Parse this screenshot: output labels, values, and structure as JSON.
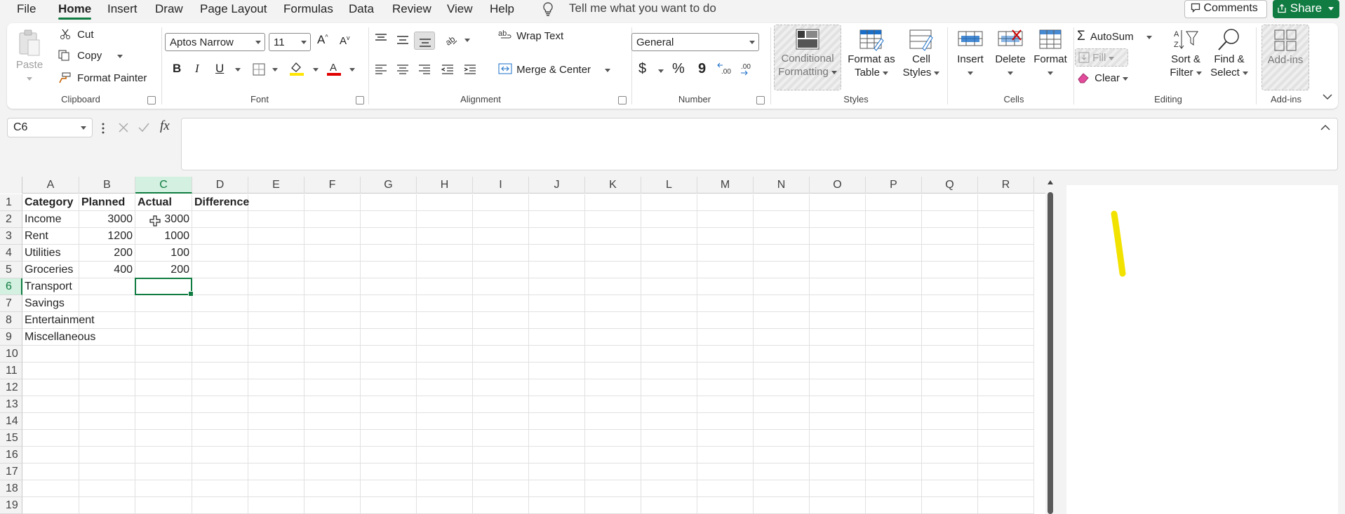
{
  "menubar": {
    "items": [
      "File",
      "Home",
      "Insert",
      "Draw",
      "Page Layout",
      "Formulas",
      "Data",
      "Review",
      "View",
      "Help"
    ],
    "active": "Home",
    "tell_me": "Tell me what you want to do",
    "comments_label": "Comments",
    "share_label": "Share"
  },
  "ribbon": {
    "clipboard": {
      "paste": "Paste",
      "cut": "Cut",
      "copy": "Copy",
      "format_painter": "Format Painter",
      "label": "Clipboard"
    },
    "font": {
      "name": "Aptos Narrow",
      "size": "11",
      "bold": "B",
      "italic": "I",
      "underline": "U",
      "label": "Font"
    },
    "alignment": {
      "wrap_text": "Wrap Text",
      "merge_center": "Merge & Center",
      "label": "Alignment"
    },
    "number": {
      "format": "General",
      "currency": "$",
      "percent": "%",
      "comma": "9",
      "label": "Number"
    },
    "styles": {
      "conditional_1": "Conditional",
      "conditional_2": "Formatting",
      "format_table_1": "Format as",
      "format_table_2": "Table",
      "cell_styles_1": "Cell",
      "cell_styles_2": "Styles",
      "label": "Styles"
    },
    "cells": {
      "insert": "Insert",
      "delete": "Delete",
      "format": "Format",
      "label": "Cells"
    },
    "editing": {
      "autosum": "AutoSum",
      "fill": "Fill",
      "clear": "Clear",
      "sort_1": "Sort &",
      "sort_2": "Filter",
      "find_1": "Find &",
      "find_2": "Select",
      "label": "Editing"
    },
    "addins": {
      "addins": "Add-ins",
      "label": "Add-ins"
    }
  },
  "formula_bar": {
    "name_box": "C6",
    "formula": ""
  },
  "sheet": {
    "columns": [
      "A",
      "B",
      "C",
      "D",
      "E",
      "F",
      "G",
      "H",
      "I",
      "J",
      "K",
      "L",
      "M",
      "N",
      "O",
      "P",
      "Q",
      "R"
    ],
    "rows": [
      "1",
      "2",
      "3",
      "4",
      "5",
      "6",
      "7",
      "8",
      "9",
      "10",
      "11",
      "12",
      "13",
      "14",
      "15",
      "16",
      "17",
      "18",
      "19"
    ],
    "selected_cell": "C6",
    "header": [
      "Category",
      "Planned",
      "Actual",
      "Difference"
    ],
    "data": [
      [
        "Income",
        "3000",
        "3000"
      ],
      [
        "Rent",
        "1200",
        "1000"
      ],
      [
        "Utilities",
        "200",
        "100"
      ],
      [
        "Groceries",
        "400",
        "200"
      ],
      [
        "Transport",
        "",
        ""
      ],
      [
        "Savings",
        "",
        ""
      ],
      [
        "Entertainment",
        "",
        ""
      ],
      [
        "Miscellaneous",
        "",
        ""
      ]
    ]
  },
  "colors": {
    "accent": "#107c41",
    "highlight_stroke": "#f2e200"
  }
}
